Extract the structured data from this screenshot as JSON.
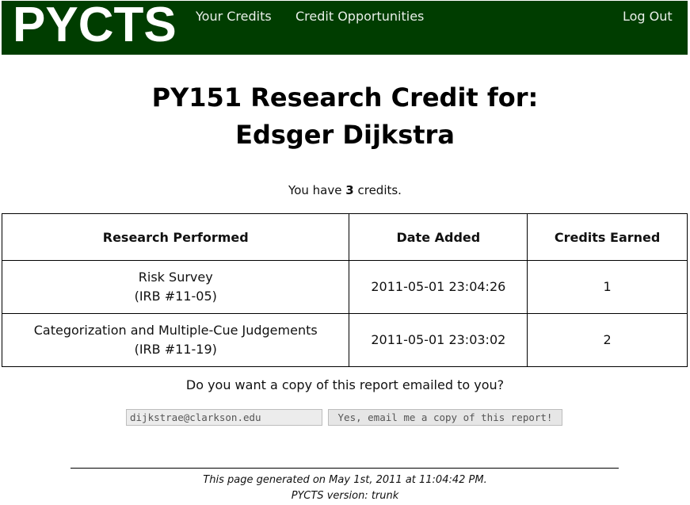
{
  "header": {
    "logo": "PYCTS",
    "nav": {
      "your_credits": "Your Credits",
      "credit_opportunities": "Credit Opportunities",
      "log_out": "Log Out"
    },
    "background": "#003d00"
  },
  "title": {
    "line1": "PY151 Research Credit for:",
    "line2": "Edsger Dijkstra"
  },
  "summary": {
    "prefix": "You have",
    "credits": "3",
    "suffix": "credits."
  },
  "table": {
    "headers": [
      "Research Performed",
      "Date Added",
      "Credits Earned"
    ],
    "rows": [
      {
        "research": "Risk Survey",
        "irb": "(IRB #11-05)",
        "date": "2011-05-01 23:04:26",
        "credits": "1"
      },
      {
        "research": "Categorization and Multiple-Cue Judgements",
        "irb": "(IRB #11-19)",
        "date": "2011-05-01 23:03:02",
        "credits": "2"
      }
    ]
  },
  "email": {
    "question": "Do you want a copy of this report emailed to you?",
    "address": "dijkstrae@clarkson.edu",
    "button_label": "Yes, email me a copy of this report!"
  },
  "footer": {
    "generated": "This page generated on May 1st, 2011 at 11:04:42 PM.",
    "version": "PYCTS version: trunk"
  }
}
